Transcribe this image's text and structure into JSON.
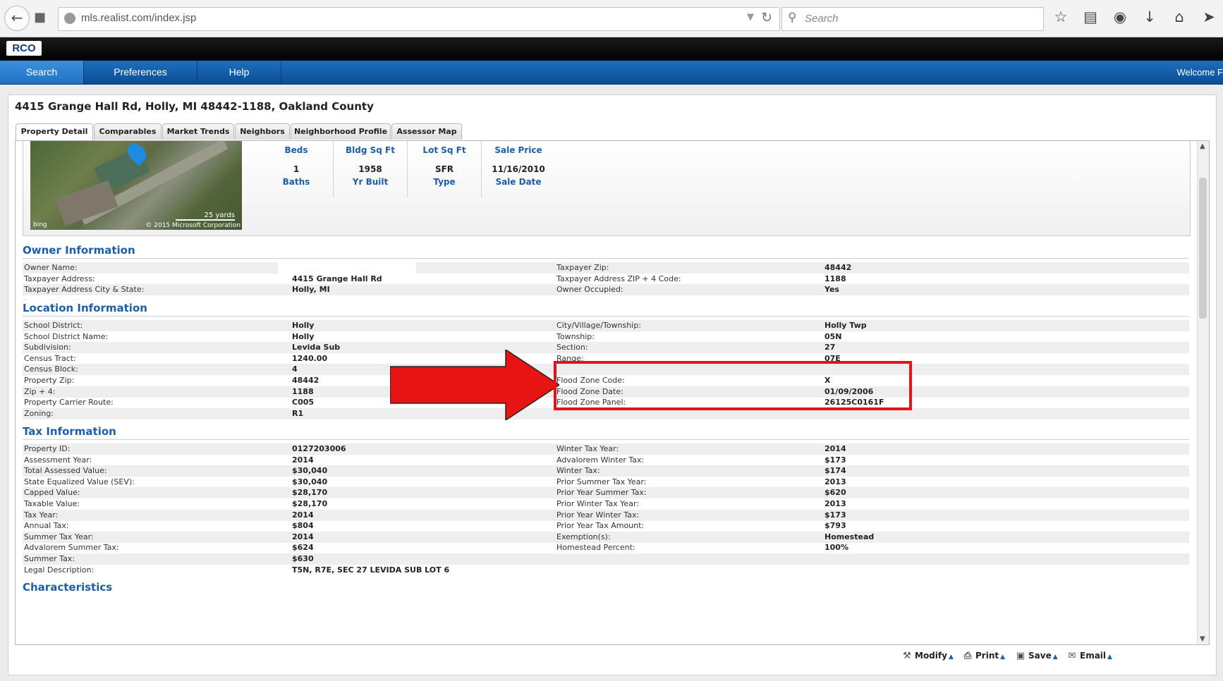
{
  "browser": {
    "url": "mls.realist.com/index.jsp",
    "search_placeholder": "Search"
  },
  "app": {
    "logo_text": "RCO",
    "nav": [
      "Search",
      "Preferences",
      "Help"
    ],
    "welcome": "Welcome F"
  },
  "property": {
    "title": "4415 Grange Hall Rd, Holly, MI 48442-1188, Oakland County",
    "tabs": [
      "Property Detail",
      "Comparables",
      "Market Trends",
      "Neighbors",
      "Neighborhood Profile",
      "Assessor Map"
    ],
    "map": {
      "scale": "25 yards",
      "brand": "bing",
      "copyright": "© 2015 Microsoft Corporation"
    },
    "summary": {
      "top_labels": [
        "Beds",
        "Bldg Sq Ft",
        "Lot Sq Ft",
        "Sale Price"
      ],
      "values": [
        "1",
        "1958",
        "SFR",
        "11/16/2010"
      ],
      "bottom_labels": [
        "Baths",
        "Yr Built",
        "Type",
        "Sale Date"
      ]
    }
  },
  "owner": {
    "heading": "Owner Information",
    "rows": [
      [
        "Owner Name:",
        "",
        "Taxpayer Zip:",
        "48442"
      ],
      [
        "Taxpayer Address:",
        "4415 Grange Hall Rd",
        "Taxpayer Address ZIP + 4 Code:",
        "1188"
      ],
      [
        "Taxpayer Address City & State:",
        "Holly, MI",
        "Owner Occupied:",
        "Yes"
      ]
    ]
  },
  "location": {
    "heading": "Location Information",
    "rows": [
      [
        "School District:",
        "Holly",
        "City/Village/Township:",
        "Holly Twp"
      ],
      [
        "School District Name:",
        "Holly",
        "Township:",
        "05N"
      ],
      [
        "Subdivision:",
        "Levida Sub",
        "Section:",
        "27"
      ],
      [
        "Census Tract:",
        "1240.00",
        "Range:",
        "07E"
      ],
      [
        "Census Block:",
        "4",
        "",
        ""
      ],
      [
        "Property Zip:",
        "48442",
        "Flood Zone Code:",
        "X"
      ],
      [
        "Zip + 4:",
        "1188",
        "Flood Zone Date:",
        "01/09/2006"
      ],
      [
        "Property Carrier Route:",
        "C005",
        "Flood Zone Panel:",
        "26125C0161F"
      ],
      [
        "Zoning:",
        "R1",
        "",
        ""
      ]
    ]
  },
  "tax": {
    "heading": "Tax Information",
    "rows": [
      [
        "Property ID:",
        "0127203006",
        "Winter Tax Year:",
        "2014"
      ],
      [
        "Assessment Year:",
        "2014",
        "Advalorem Winter Tax:",
        "$173"
      ],
      [
        "Total Assessed Value:",
        "$30,040",
        "Winter Tax:",
        "$174"
      ],
      [
        "State Equalized Value (SEV):",
        "$30,040",
        "Prior Summer Tax Year:",
        "2013"
      ],
      [
        "Capped Value:",
        "$28,170",
        "Prior Year Summer Tax:",
        "$620"
      ],
      [
        "Taxable Value:",
        "$28,170",
        "Prior Winter Tax Year:",
        "2013"
      ],
      [
        "Tax Year:",
        "2014",
        "Prior Year Winter Tax:",
        "$173"
      ],
      [
        "Annual Tax:",
        "$804",
        "Prior Year Tax Amount:",
        "$793"
      ],
      [
        "Summer Tax Year:",
        "2014",
        "Exemption(s):",
        "Homestead"
      ],
      [
        "Advalorem Summer Tax:",
        "$624",
        "Homestead Percent:",
        "100%"
      ],
      [
        "Summer Tax:",
        "$630",
        "",
        ""
      ],
      [
        "Legal Description:",
        "T5N, R7E, SEC 27 LEVIDA SUB LOT 6",
        "",
        ""
      ]
    ]
  },
  "characteristics": {
    "heading": "Characteristics"
  },
  "actions": [
    "Modify",
    "Print",
    "Save",
    "Email"
  ],
  "colors": {
    "nav_blue": "#0a4d95",
    "heading_blue": "#1d5ea6",
    "annotation_red": "#e81313"
  }
}
